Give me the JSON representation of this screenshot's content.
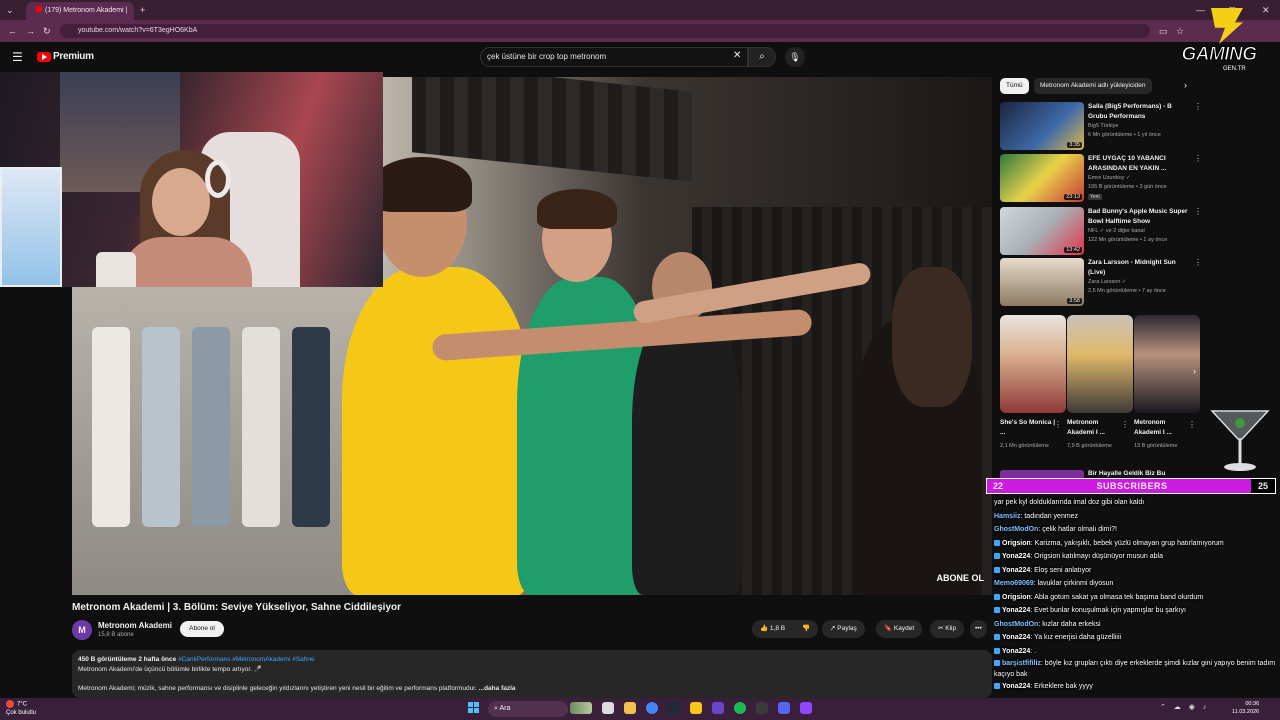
{
  "browser": {
    "tab_title": "(179) Metronom Akademi |",
    "url": "youtube.com/watch?v=6T3egHO6KbA",
    "new_tab": "+"
  },
  "youtube": {
    "logo_text": "Premium",
    "search_value": "çek üstüne bir crop top metronom",
    "video": {
      "overlay_text": "ABONE OL"
    },
    "title": "Metronom Akademi | 3. Bölüm: Seviye Yükseliyor, Sahne Ciddileşiyor",
    "channel": {
      "avatar_letter": "M",
      "name": "Metronom Akademi",
      "subs": "15,8 B abone",
      "subscribe": "Abone ol"
    },
    "actions": {
      "likes": "1,8 B",
      "share": "Paylaş",
      "save": "Kaydet",
      "clip": "Klip",
      "more": "•••"
    },
    "description": {
      "stats": "450 B görüntüleme  2 hafta önce",
      "tags": "#CanlıPerformans #MetronomAkademi #Sahne",
      "line2": "Metronom Akademi'de üçüncü bölümle birlikte tempo artıyor. 🎤",
      "line3": "Metronom Akademi; müzik, sahne performansı ve disiplinle geleceğin yıldızlarını yetiştiren yeni nesil bir eğitim ve performans platformudur.",
      "more": "...daha fazla"
    },
    "chips": [
      "Tümü",
      "Metronom Akademi adlı yükleyiciden"
    ],
    "recommendations": [
      {
        "title": "Salla (Big5 Performans) - B Grubu Performans",
        "channel": "Big5 Türkiye",
        "meta": "6 Mn görüntüleme • 1 yıl önce",
        "duration": "3:35"
      },
      {
        "title": "EFE UYGAÇ 10 YABANCI ARASINDAN EN YAKIN ...",
        "channel": "Emre Uzunboy ✓",
        "meta": "195 B görüntüleme • 3 gün önce",
        "badge": "Yeni",
        "duration": "23:13"
      },
      {
        "title": "Bad Bunny's Apple Music Super Bowl Halftime Show",
        "channel": "NFL ✓ ve 2 diğer kanal",
        "meta": "122 Mn görüntüleme • 1 ay önce",
        "duration": "13:42"
      },
      {
        "title": "Zara Larsson - Midnight Sun (Live)",
        "channel": "Zara Larsson ✓",
        "meta": "2,5 Mn görüntüleme • 7 ay önce",
        "duration": "3:58"
      }
    ],
    "shorts": [
      {
        "title": "She's So Monica | ...",
        "meta": "2,1 Mn görüntüleme"
      },
      {
        "title": "Metronom Akademi I ...",
        "meta": "7,9 B görüntüleme"
      },
      {
        "title": "Metronom Akademi I ...",
        "meta": "13 B görüntüleme"
      }
    ],
    "partial_rec": "Bir Hayalle Geldik Biz Bu"
  },
  "overlay": {
    "logo_main": "GAMING",
    "logo_sub": "GEN.TR",
    "subs_left": "22",
    "subs_label": "SUBSCRIBERS",
    "subs_right": "25"
  },
  "chat": [
    {
      "user": "",
      "text": "yar pek kyl dolduklarında imal doz gibi olan kaldı"
    },
    {
      "user": "Hamsiiz",
      "text": ": tadından yenmez"
    },
    {
      "user": "GhostModOn",
      "text": ": çelik hatlar olmalı dimi?!"
    },
    {
      "user": "Origsion",
      "text": ": Karizma, yakışıklı, bebek yüzlü olmayan grup hatırlamıyorum"
    },
    {
      "user": "Yona224",
      "text": ": Origsion katılmayı düşünüyor musun abla"
    },
    {
      "user": "Yona224",
      "text": ": Eloş seni anlatıyor"
    },
    {
      "user": "Memo69069",
      "text": ": lavuklar çirkinmi diyosun"
    },
    {
      "user": "Origsion",
      "text": ": Abla gotum sakat ya olmasa tek başıma band olurdum"
    },
    {
      "user": "Yona224",
      "text": ": Evet bunlar konuşulmak için yapmışlar bu şarkıyı"
    },
    {
      "user": "GhostModOn",
      "text": ": kızlar daha erkeksi"
    },
    {
      "user": "Yona224",
      "text": ": Ya kız enerjisi daha güzelliiii"
    },
    {
      "user": "Yona224",
      "text": ": ."
    },
    {
      "user": "barşistfifiliz",
      "text": ": böyle kız grupları çıktı diye erkeklerde şimdi kızlar gini yapıyo benim tadım kaçıyo bak"
    },
    {
      "user": "Yona224",
      "text": ": Erkeklere bak yyyy"
    }
  ],
  "taskbar": {
    "weather_temp": "7°C",
    "weather_desc": "Çok bulutlu",
    "search": "Ara",
    "time": "00:36",
    "date": "11.03.2026"
  }
}
